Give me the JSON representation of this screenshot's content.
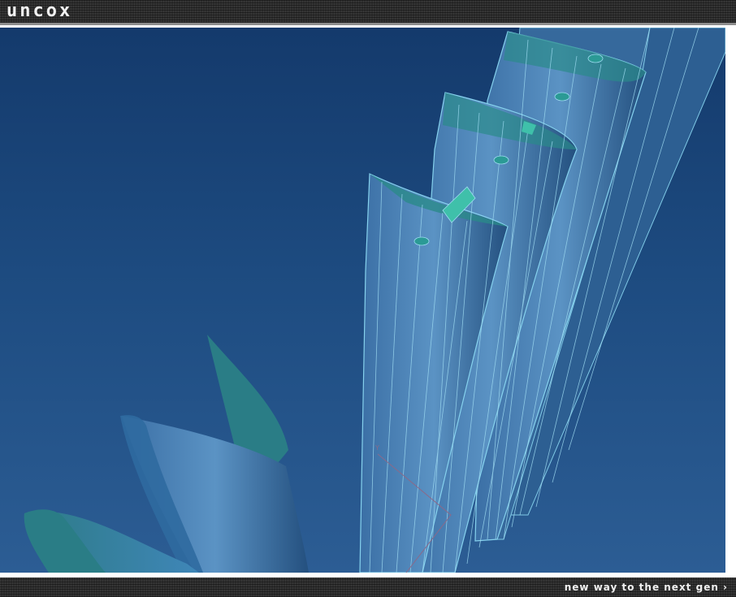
{
  "header": {
    "logo_text": "uncox"
  },
  "footer": {
    "tagline": "new way to the next gen ›"
  },
  "viewport": {
    "description_icon": "cad-3d-blade-render"
  },
  "colors": {
    "accent": "#2a9a95",
    "background_top": "#143a6c",
    "background_bottom": "#2c5d94"
  }
}
